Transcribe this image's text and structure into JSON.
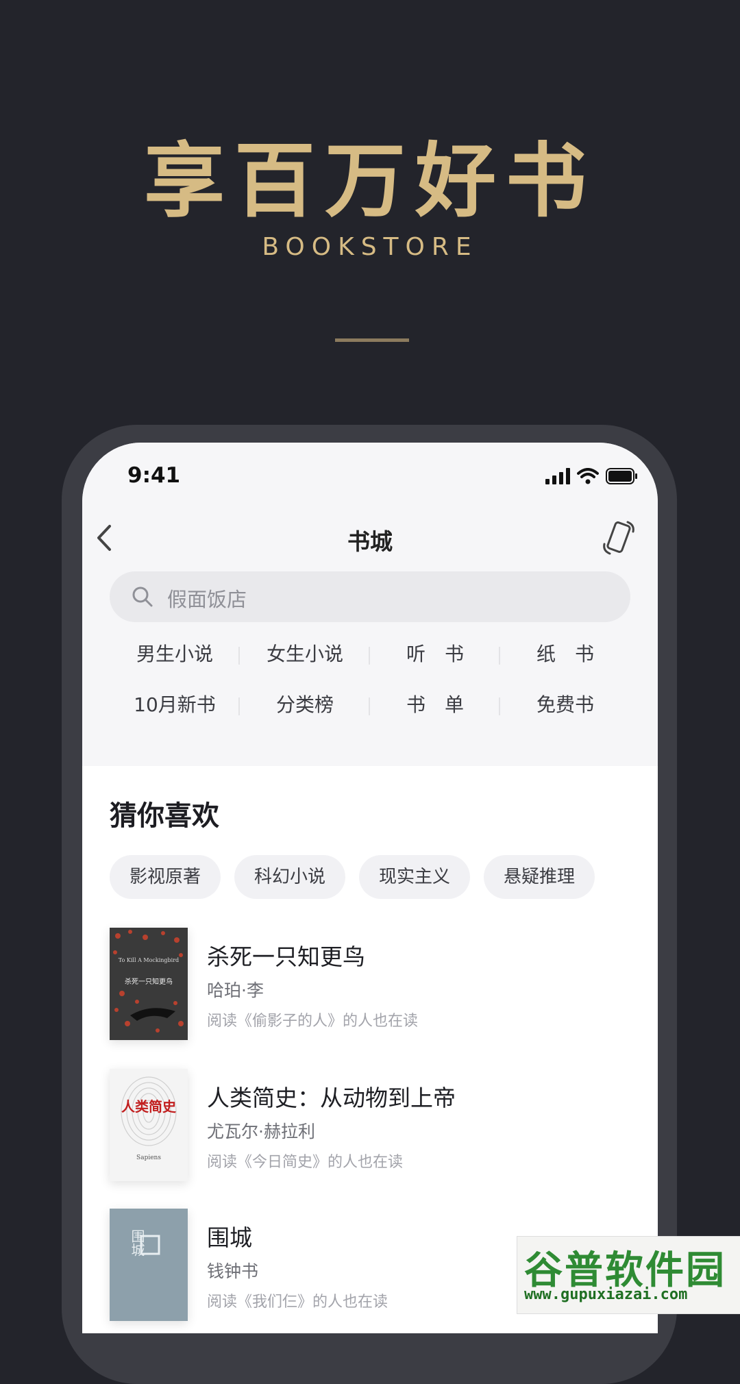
{
  "hero": {
    "title": "享百万好书",
    "subtitle": "BOOKSTORE"
  },
  "status_bar": {
    "time": "9:41"
  },
  "nav": {
    "title": "书城",
    "back_icon": "chevron-left-icon",
    "device_icon": "phone-rotate-icon"
  },
  "search": {
    "placeholder": "假面饭店"
  },
  "categories": [
    "男生小说",
    "女生小说",
    "听　书",
    "纸　书",
    "10月新书",
    "分类榜",
    "书　单",
    "免费书"
  ],
  "recommend": {
    "title": "猜你喜欢",
    "chips": [
      "影视原著",
      "科幻小说",
      "现实主义",
      "悬疑推理"
    ]
  },
  "books": [
    {
      "title": "杀死一只知更鸟",
      "author": "哈珀·李",
      "reason": "阅读《偷影子的人》的人也在读",
      "cover_text": "杀死一只知更鸟",
      "cover_text_en": "To Kill A Mockingbird",
      "cover_color": "#3a3a3a"
    },
    {
      "title": "人类简史：从动物到上帝",
      "author": "尤瓦尔·赫拉利",
      "reason": "阅读《今日简史》的人也在读",
      "cover_text": "人类简史",
      "cover_text_en": "Sapiens",
      "cover_color": "#f4f4f4"
    },
    {
      "title": "围城",
      "author": "钱钟书",
      "reason": "阅读《我们仨》的人也在读",
      "cover_text": "围城",
      "cover_color": "#8da0ab"
    }
  ],
  "watermark": {
    "brand": "谷普软件园",
    "url": "www.gupuxiazai.com"
  }
}
